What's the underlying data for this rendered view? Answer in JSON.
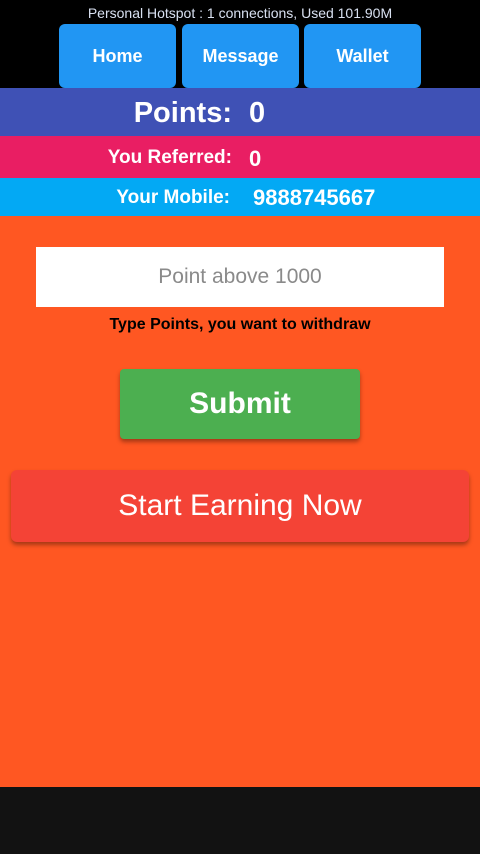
{
  "status_bar": {
    "text": "Personal Hotspot : 1 connections, Used 101.90M"
  },
  "nav": {
    "home": "Home",
    "message": "Message",
    "wallet": "Wallet"
  },
  "stats": {
    "points_label": "Points:",
    "points_value": "0",
    "referred_label": "You Referred:",
    "referred_value": "0",
    "mobile_label": "Your Mobile:",
    "mobile_value": "9888745667"
  },
  "withdraw": {
    "placeholder": "Point above 1000",
    "hint": "Type Points, you want to withdraw",
    "submit_label": "Submit"
  },
  "earn_label": "Start Earning Now",
  "colors": {
    "nav_button": "#2196f3",
    "points_row": "#3f51b5",
    "referred_row": "#e91e63",
    "mobile_row": "#03a9f4",
    "background": "#ff5722",
    "submit": "#4caf50",
    "earn": "#f44336"
  }
}
